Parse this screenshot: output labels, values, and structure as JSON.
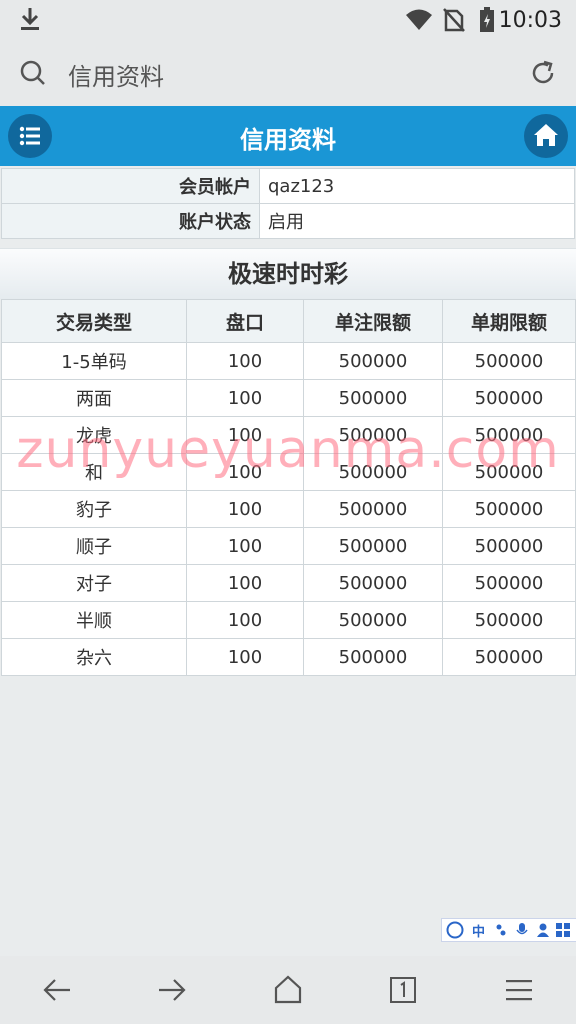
{
  "status_bar": {
    "time": "10:03"
  },
  "browser": {
    "title": "信用资料"
  },
  "header": {
    "title": "信用资料"
  },
  "account": [
    {
      "label": "会员帐户",
      "value": "qaz123"
    },
    {
      "label": "账户状态",
      "value": "启用"
    }
  ],
  "section": {
    "title": "极速时时彩"
  },
  "table": {
    "columns": [
      "交易类型",
      "盘口",
      "单注限额",
      "单期限额"
    ],
    "rows": [
      [
        "1-5单码",
        "100",
        "500000",
        "500000"
      ],
      [
        "两面",
        "100",
        "500000",
        "500000"
      ],
      [
        "龙虎",
        "100",
        "500000",
        "500000"
      ],
      [
        "和",
        "100",
        "500000",
        "500000"
      ],
      [
        "豹子",
        "100",
        "500000",
        "500000"
      ],
      [
        "顺子",
        "100",
        "500000",
        "500000"
      ],
      [
        "对子",
        "100",
        "500000",
        "500000"
      ],
      [
        "半顺",
        "100",
        "500000",
        "500000"
      ],
      [
        "杂六",
        "100",
        "500000",
        "500000"
      ]
    ]
  },
  "watermark": "zunyueyuanma.com",
  "ime": {
    "label": "中"
  }
}
